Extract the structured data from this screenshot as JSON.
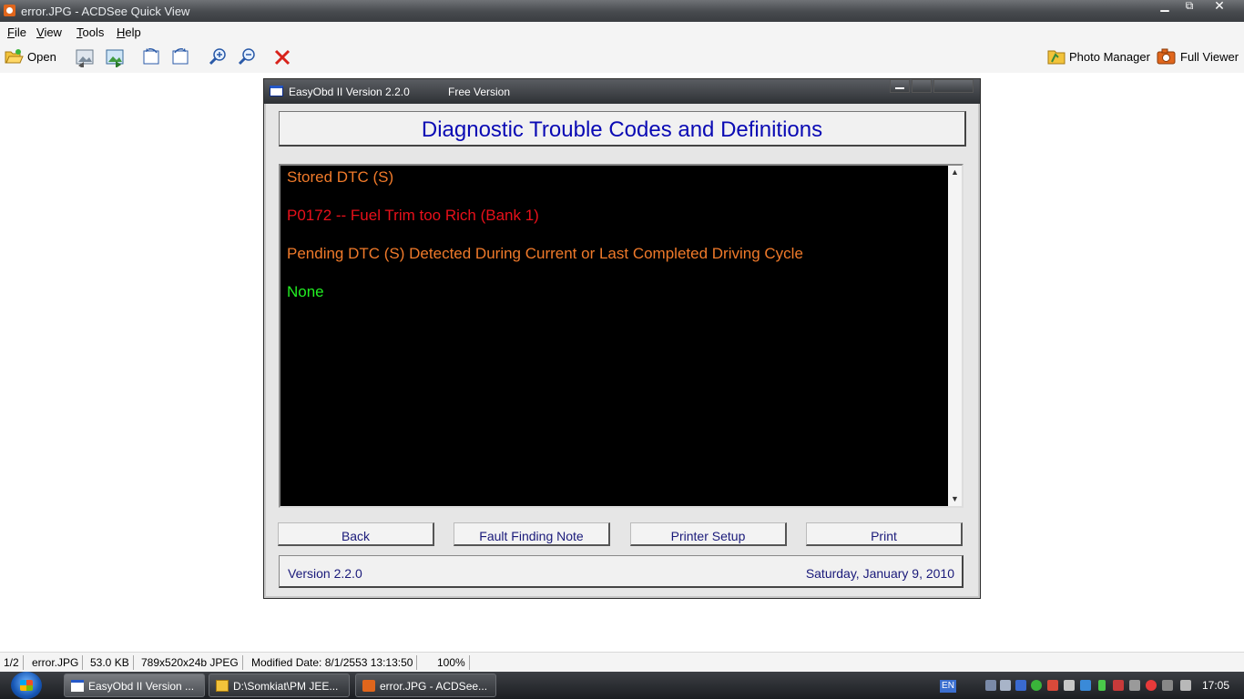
{
  "window": {
    "title": "error.JPG - ACDSee Quick View",
    "controls": [
      "minimize",
      "restore",
      "close"
    ]
  },
  "menu": {
    "items": [
      {
        "label": "File",
        "mnemonic": "F"
      },
      {
        "label": "View",
        "mnemonic": "V"
      },
      {
        "label": "Tools",
        "mnemonic": "T"
      },
      {
        "label": "Help",
        "mnemonic": "H"
      }
    ]
  },
  "toolbar": {
    "open_label": "Open",
    "icons": [
      "previous-image-icon",
      "next-image-icon",
      "rotate-left-icon",
      "rotate-right-icon",
      "zoom-in-icon",
      "zoom-out-icon",
      "delete-icon"
    ],
    "photo_manager_label": "Photo Manager",
    "full_viewer_label": "Full Viewer"
  },
  "easyobd": {
    "title": "EasyObd II Version 2.2.0",
    "edition": "Free Version",
    "header": "Diagnostic Trouble Codes and Definitions",
    "lines": [
      {
        "text": "Stored DTC (S)",
        "color": "#f07a2a"
      },
      {
        "text": "P0172  --  Fuel Trim too Rich (Bank 1)",
        "color": "#e8101a"
      },
      {
        "text": "Pending DTC (S) Detected During Current or Last Completed Driving Cycle",
        "color": "#f07a2a"
      },
      {
        "text": "None",
        "color": "#22ee22"
      }
    ],
    "buttons": {
      "back": "Back",
      "fault_note": "Fault Finding Note",
      "printer_setup": "Printer Setup",
      "print": "Print"
    },
    "footer": {
      "version": "Version 2.2.0",
      "date": "Saturday, January 9, 2010"
    }
  },
  "statusbar": {
    "index": "1/2",
    "filename": "error.JPG",
    "size": "53.0 KB",
    "dimensions": "789x520x24b JPEG",
    "modified": "Modified Date: 8/1/2553 13:13:50",
    "zoom": "100%"
  },
  "taskbar": {
    "tasks": [
      {
        "label": "EasyObd II Version ...",
        "active": true
      },
      {
        "label": "D:\\Somkiat\\PM JEE...",
        "active": false
      },
      {
        "label": "error.JPG - ACDSee...",
        "active": false
      }
    ],
    "language": "EN",
    "clock": "17:05"
  },
  "colors": {
    "header_text": "#0a0ab4",
    "button_text": "#1a1a7a",
    "panel_bg": "#000000"
  }
}
